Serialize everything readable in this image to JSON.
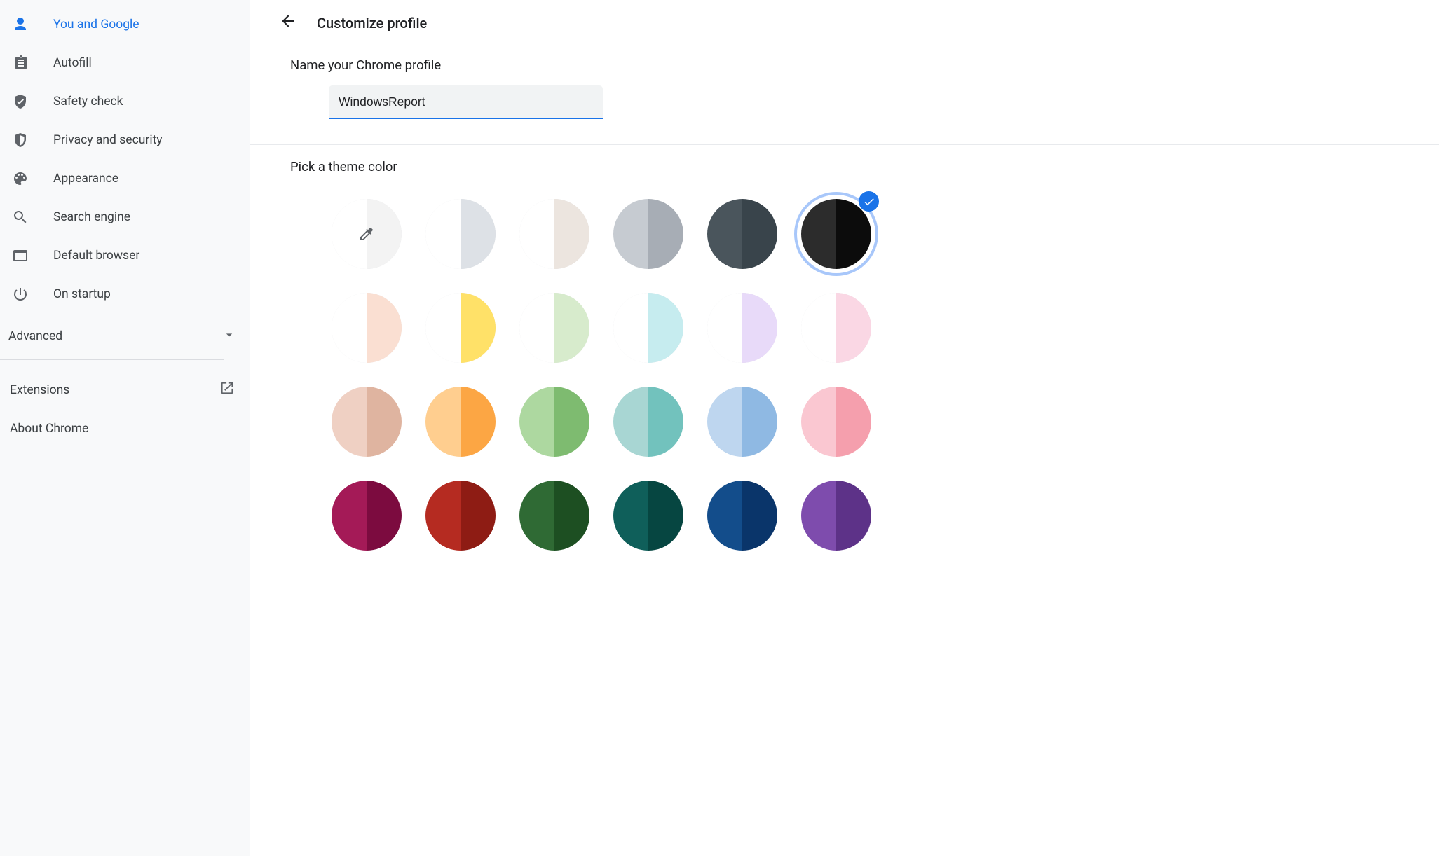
{
  "sidebar": {
    "items": [
      {
        "id": "you-and-google",
        "label": "You and Google",
        "icon": "person",
        "active": true
      },
      {
        "id": "autofill",
        "label": "Autofill",
        "icon": "clipboard",
        "active": false
      },
      {
        "id": "safety-check",
        "label": "Safety check",
        "icon": "shield-check",
        "active": false
      },
      {
        "id": "privacy-security",
        "label": "Privacy and security",
        "icon": "shield",
        "active": false
      },
      {
        "id": "appearance",
        "label": "Appearance",
        "icon": "palette",
        "active": false
      },
      {
        "id": "search-engine",
        "label": "Search engine",
        "icon": "search",
        "active": false
      },
      {
        "id": "default-browser",
        "label": "Default browser",
        "icon": "browser",
        "active": false
      },
      {
        "id": "on-startup",
        "label": "On startup",
        "icon": "power",
        "active": false
      }
    ],
    "advanced_label": "Advanced",
    "extensions_label": "Extensions",
    "about_label": "About Chrome"
  },
  "main": {
    "page_title": "Customize profile",
    "name_section_heading": "Name your Chrome profile",
    "profile_name_value": "WindowsReport",
    "theme_section_heading": "Pick a theme color",
    "theme_colors": [
      {
        "id": "custom",
        "type": "eyedropper",
        "left": "#ffffff",
        "right": "#f3f3f3",
        "border": true
      },
      {
        "id": "light-grey",
        "left": "#ffffff",
        "right": "#dde1e6",
        "border": true
      },
      {
        "id": "warm-beige",
        "left": "#ffffff",
        "right": "#ece5df",
        "border": true
      },
      {
        "id": "cool-grey",
        "left": "#c6cbd1",
        "right": "#a7adb5"
      },
      {
        "id": "dark-slate",
        "left": "#4a555c",
        "right": "#39444b"
      },
      {
        "id": "black",
        "left": "#2c2c2c",
        "right": "#0c0c0c",
        "selected": true
      },
      {
        "id": "peach-light",
        "left": "#ffffff",
        "right": "#fadfd2",
        "border": true
      },
      {
        "id": "yellow-light",
        "left": "#ffffff",
        "right": "#ffe168",
        "border": true
      },
      {
        "id": "green-light",
        "left": "#ffffff",
        "right": "#d7ebcc",
        "border": true
      },
      {
        "id": "cyan-light",
        "left": "#ffffff",
        "right": "#c6ecef",
        "border": true
      },
      {
        "id": "lavender-light",
        "left": "#ffffff",
        "right": "#e8daf9",
        "border": true
      },
      {
        "id": "pink-light",
        "left": "#ffffff",
        "right": "#fad7e4",
        "border": true
      },
      {
        "id": "peach",
        "left": "#efd0c3",
        "right": "#dfb4a0"
      },
      {
        "id": "orange",
        "left": "#ffce8f",
        "right": "#fca644"
      },
      {
        "id": "green",
        "left": "#add8a0",
        "right": "#7ebb70"
      },
      {
        "id": "teal",
        "left": "#a8d6d3",
        "right": "#72c2bd"
      },
      {
        "id": "blue",
        "left": "#bed6ef",
        "right": "#8fb9e3"
      },
      {
        "id": "pink",
        "left": "#fac7d1",
        "right": "#f59fad"
      },
      {
        "id": "magenta-dark",
        "left": "#a41a57",
        "right": "#7c0b3f"
      },
      {
        "id": "red-dark",
        "left": "#b52b21",
        "right": "#8e1c14"
      },
      {
        "id": "green-dark",
        "left": "#2f6a34",
        "right": "#1d4f22"
      },
      {
        "id": "teal-dark",
        "left": "#0f5f5a",
        "right": "#064641"
      },
      {
        "id": "navy",
        "left": "#134d8b",
        "right": "#0a356a"
      },
      {
        "id": "purple",
        "left": "#7e4cad",
        "right": "#5d3288"
      }
    ]
  }
}
